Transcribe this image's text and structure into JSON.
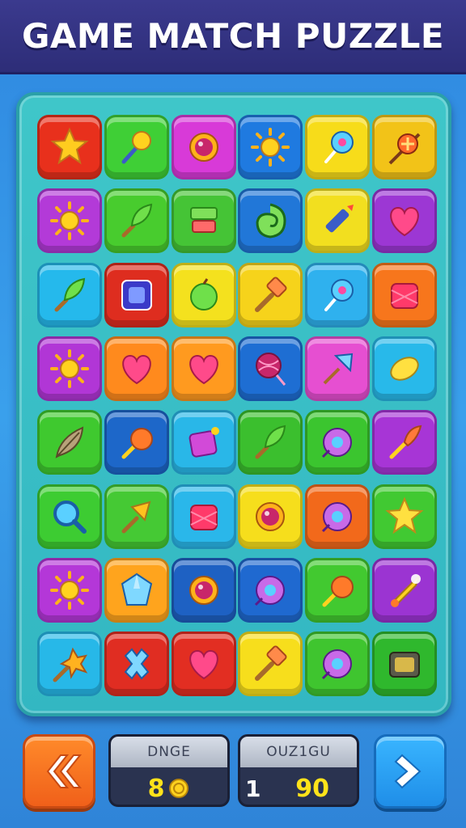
{
  "header": {
    "title": "GAME MATCH PUZZLE"
  },
  "board": {
    "rows": [
      [
        {
          "icon": "star-badge-icon",
          "color": "#e8301c"
        },
        {
          "icon": "magic-wand-icon",
          "color": "#3fcf36"
        },
        {
          "icon": "ring-gem-icon",
          "color": "#d83ad8"
        },
        {
          "icon": "sun-icon",
          "color": "#1f7ae0"
        },
        {
          "icon": "lollipop-icon",
          "color": "#f7dc1a"
        },
        {
          "icon": "candy-wand-icon",
          "color": "#f2c318"
        }
      ],
      [
        {
          "icon": "sun-icon",
          "color": "#b33ad8"
        },
        {
          "icon": "leaf-wand-icon",
          "color": "#48cc2e"
        },
        {
          "icon": "stack-block-icon",
          "color": "#45c436"
        },
        {
          "icon": "swirl-icon",
          "color": "#2177d8"
        },
        {
          "icon": "crayon-icon",
          "color": "#f2df1f"
        },
        {
          "icon": "heart-icon",
          "color": "#9c37d4"
        }
      ],
      [
        {
          "icon": "leaf-wand-icon",
          "color": "#25b9ec"
        },
        {
          "icon": "gem-box-icon",
          "color": "#de2d1f"
        },
        {
          "icon": "apple-icon",
          "color": "#f4e11e"
        },
        {
          "icon": "hammer-icon",
          "color": "#f6d31b"
        },
        {
          "icon": "lollipop-icon",
          "color": "#2fb1ee"
        },
        {
          "icon": "box-icon",
          "color": "#f7761c"
        }
      ],
      [
        {
          "icon": "sun-icon",
          "color": "#b136d6"
        },
        {
          "icon": "heart-icon",
          "color": "#ff8a1d"
        },
        {
          "icon": "heart-icon",
          "color": "#ff9a1f"
        },
        {
          "icon": "yarn-ball-icon",
          "color": "#1e6ed3"
        },
        {
          "icon": "spear-icon",
          "color": "#e64fd1"
        },
        {
          "icon": "lemon-icon",
          "color": "#28b9ea"
        }
      ],
      [
        {
          "icon": "feather-icon",
          "color": "#3fc92f"
        },
        {
          "icon": "orb-wand-icon",
          "color": "#1d67c9"
        },
        {
          "icon": "gift-icon",
          "color": "#29b7e8"
        },
        {
          "icon": "leaf-wand-icon",
          "color": "#3bbf2e"
        },
        {
          "icon": "donut-icon",
          "color": "#3bc52f"
        },
        {
          "icon": "torch-icon",
          "color": "#a735d6"
        }
      ],
      [
        {
          "icon": "magnifier-icon",
          "color": "#3dcc32"
        },
        {
          "icon": "spade-icon",
          "color": "#45c934"
        },
        {
          "icon": "box-icon",
          "color": "#2ab7ea"
        },
        {
          "icon": "ring-gem-icon",
          "color": "#f6de1c"
        },
        {
          "icon": "donut-icon",
          "color": "#f2691b"
        },
        {
          "icon": "star-icon",
          "color": "#41c932"
        }
      ],
      [
        {
          "icon": "sun-icon",
          "color": "#b437d8"
        },
        {
          "icon": "crystal-icon",
          "color": "#ffa41d"
        },
        {
          "icon": "ring-gem-icon",
          "color": "#1e61c3"
        },
        {
          "icon": "donut-icon",
          "color": "#1f69d0"
        },
        {
          "icon": "orb-wand-icon",
          "color": "#42c930"
        },
        {
          "icon": "rocket-icon",
          "color": "#9b34d2"
        }
      ],
      [
        {
          "icon": "spiky-wand-icon",
          "color": "#27b8e8"
        },
        {
          "icon": "cross-icon",
          "color": "#e02d22"
        },
        {
          "icon": "heart-icon",
          "color": "#e22e22"
        },
        {
          "icon": "hammer-icon",
          "color": "#f7de1c"
        },
        {
          "icon": "donut-icon",
          "color": "#3fc52f"
        },
        {
          "icon": "chest-icon",
          "color": "#2fb82d"
        }
      ]
    ]
  },
  "footer": {
    "back_button_icon": "double-chevron-left-icon",
    "next_button_icon": "chevron-right-icon",
    "left_panel": {
      "label": "DNGE",
      "value": "8",
      "extra_icon": "coin-icon"
    },
    "right_panel": {
      "label": "OUZ1GU",
      "left_value": "1",
      "value": "90"
    }
  }
}
